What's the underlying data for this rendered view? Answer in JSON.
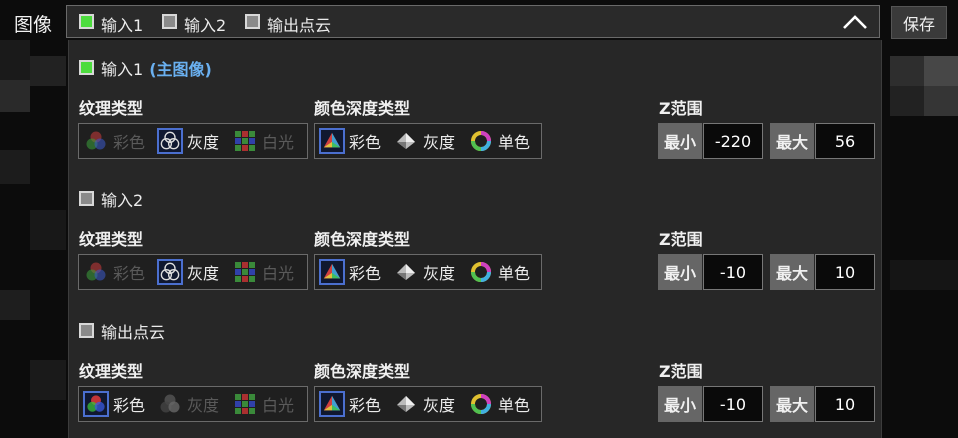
{
  "top": {
    "label": "图像",
    "save_label": "保存",
    "combo_items": [
      {
        "label": "输入1",
        "checked": true
      },
      {
        "label": "输入2",
        "checked": false
      },
      {
        "label": "输出点云",
        "checked": false
      }
    ]
  },
  "sections": [
    {
      "title": "输入1",
      "title_accent": "(主图像)",
      "checked": true,
      "texture_header": "纹理类型",
      "texture_options": [
        {
          "label": "彩色",
          "selected": false,
          "enabled": false,
          "icon": "rgb-circles-icon"
        },
        {
          "label": "灰度",
          "selected": true,
          "enabled": true,
          "icon": "gray-circles-icon"
        },
        {
          "label": "白光",
          "selected": false,
          "enabled": false,
          "icon": "bayer-grid-icon"
        }
      ],
      "depth_header": "颜色深度类型",
      "depth_options": [
        {
          "label": "彩色",
          "selected": true,
          "icon": "color-pyramid-icon"
        },
        {
          "label": "灰度",
          "selected": false,
          "icon": "gray-pyramid-icon"
        },
        {
          "label": "单色",
          "selected": false,
          "icon": "color-ring-icon"
        }
      ],
      "z_header": "Z范围",
      "z_min_label": "最小",
      "z_min": "-220",
      "z_max_label": "最大",
      "z_max": "56"
    },
    {
      "title": "输入2",
      "title_accent": "",
      "checked": false,
      "texture_header": "纹理类型",
      "texture_options": [
        {
          "label": "彩色",
          "selected": false,
          "enabled": false,
          "icon": "rgb-circles-icon"
        },
        {
          "label": "灰度",
          "selected": true,
          "enabled": true,
          "icon": "gray-circles-icon"
        },
        {
          "label": "白光",
          "selected": false,
          "enabled": false,
          "icon": "bayer-grid-icon"
        }
      ],
      "depth_header": "颜色深度类型",
      "depth_options": [
        {
          "label": "彩色",
          "selected": true,
          "icon": "color-pyramid-icon"
        },
        {
          "label": "灰度",
          "selected": false,
          "icon": "gray-pyramid-icon"
        },
        {
          "label": "单色",
          "selected": false,
          "icon": "color-ring-icon"
        }
      ],
      "z_header": "Z范围",
      "z_min_label": "最小",
      "z_min": "-10",
      "z_max_label": "最大",
      "z_max": "10"
    },
    {
      "title": "输出点云",
      "title_accent": "",
      "checked": false,
      "texture_header": "纹理类型",
      "texture_options": [
        {
          "label": "彩色",
          "selected": true,
          "enabled": true,
          "icon": "rgb-circles-icon"
        },
        {
          "label": "灰度",
          "selected": false,
          "enabled": false,
          "icon": "gray-circles-icon"
        },
        {
          "label": "白光",
          "selected": false,
          "enabled": false,
          "icon": "bayer-grid-icon"
        }
      ],
      "depth_header": "颜色深度类型",
      "depth_options": [
        {
          "label": "彩色",
          "selected": true,
          "icon": "color-pyramid-icon"
        },
        {
          "label": "灰度",
          "selected": false,
          "icon": "gray-pyramid-icon"
        },
        {
          "label": "单色",
          "selected": false,
          "icon": "color-ring-icon"
        }
      ],
      "z_header": "Z范围",
      "z_min_label": "最小",
      "z_min": "-10",
      "z_max_label": "最大",
      "z_max": "10"
    }
  ],
  "colors": {
    "checked_green": "#4ddc3e",
    "accent_blue": "#6ab0f0",
    "selected_border": "#4b6fcf"
  }
}
